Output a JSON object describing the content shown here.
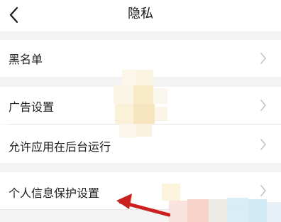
{
  "nav": {
    "title": "隐私",
    "back_icon": "chevron-left-icon"
  },
  "rows": [
    {
      "label": "黑名单",
      "icon": "chevron-right-icon"
    },
    {
      "label": "广告设置",
      "icon": "chevron-right-icon"
    },
    {
      "label": "允许应用在后台运行",
      "icon": "chevron-right-icon"
    },
    {
      "label": "个人信息保护设置",
      "icon": "chevron-right-icon"
    }
  ],
  "colors": {
    "background": "#f3f3f3",
    "surface": "#ffffff",
    "text": "#1e1e1e",
    "chevron": "#c4c4c4",
    "annotation_arrow": "#cc1f1f"
  }
}
